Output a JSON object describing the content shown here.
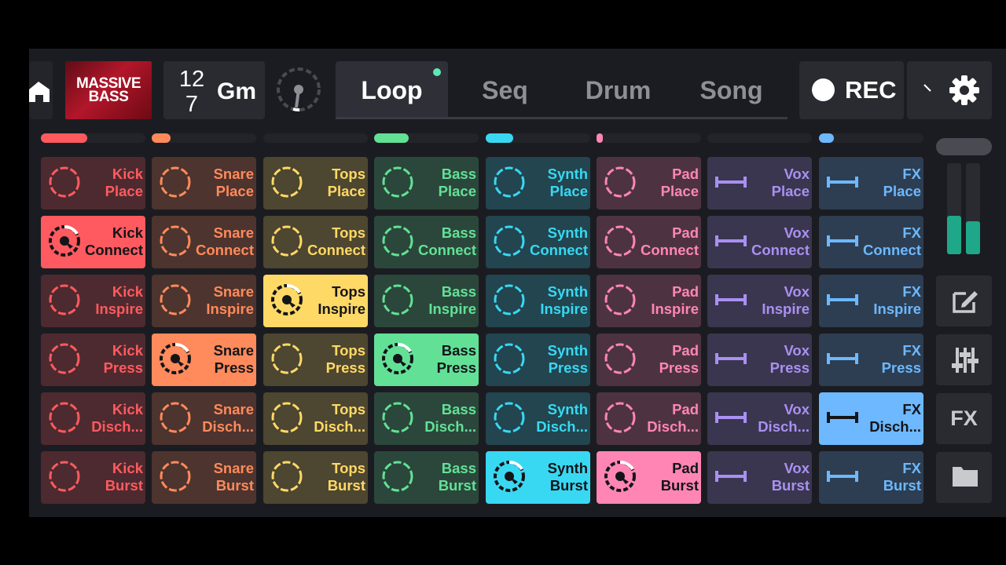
{
  "header": {
    "album_art": {
      "line1": "MASSIVE",
      "line2": "BASS"
    },
    "tempo_line1": "12",
    "tempo_line2": "7",
    "key": "Gm",
    "tabs": [
      {
        "label": "Loop",
        "active": true
      },
      {
        "label": "Seq",
        "active": false
      },
      {
        "label": "Drum",
        "active": false
      },
      {
        "label": "Song",
        "active": false
      }
    ],
    "rec_label": "REC"
  },
  "sidebar": {
    "fx_label": "FX",
    "icons": [
      "edit-icon",
      "mixer-sliders-icon",
      "folder-icon",
      "settings-gear-icon",
      "home-icon"
    ]
  },
  "rows": [
    "Place",
    "Connect",
    "Inspire",
    "Press",
    "Disch...",
    "Burst"
  ],
  "columns": [
    {
      "name": "Kick",
      "color": "#ff5a5f",
      "icon": "ring",
      "level": 0.44,
      "active_row": 1
    },
    {
      "name": "Snare",
      "color": "#ff8a5b",
      "icon": "ring",
      "level": 0.18,
      "active_row": 3
    },
    {
      "name": "Tops",
      "color": "#ffd966",
      "icon": "ring",
      "level": 0.0,
      "active_row": 2
    },
    {
      "name": "Bass",
      "color": "#62e196",
      "icon": "ring",
      "level": 0.33,
      "active_row": 3
    },
    {
      "name": "Synth",
      "color": "#39d8f2",
      "icon": "ring",
      "level": 0.26,
      "active_row": 5
    },
    {
      "name": "Pad",
      "color": "#ff86b4",
      "icon": "ring",
      "level": 0.03,
      "active_row": 5
    },
    {
      "name": "Vox",
      "color": "#a990f2",
      "icon": "bar",
      "level": 0.0,
      "active_row": -1
    },
    {
      "name": "FX",
      "color": "#6db8ff",
      "icon": "bar",
      "level": 0.14,
      "active_row": 4
    }
  ],
  "master_levels": [
    0.42,
    0.36
  ]
}
